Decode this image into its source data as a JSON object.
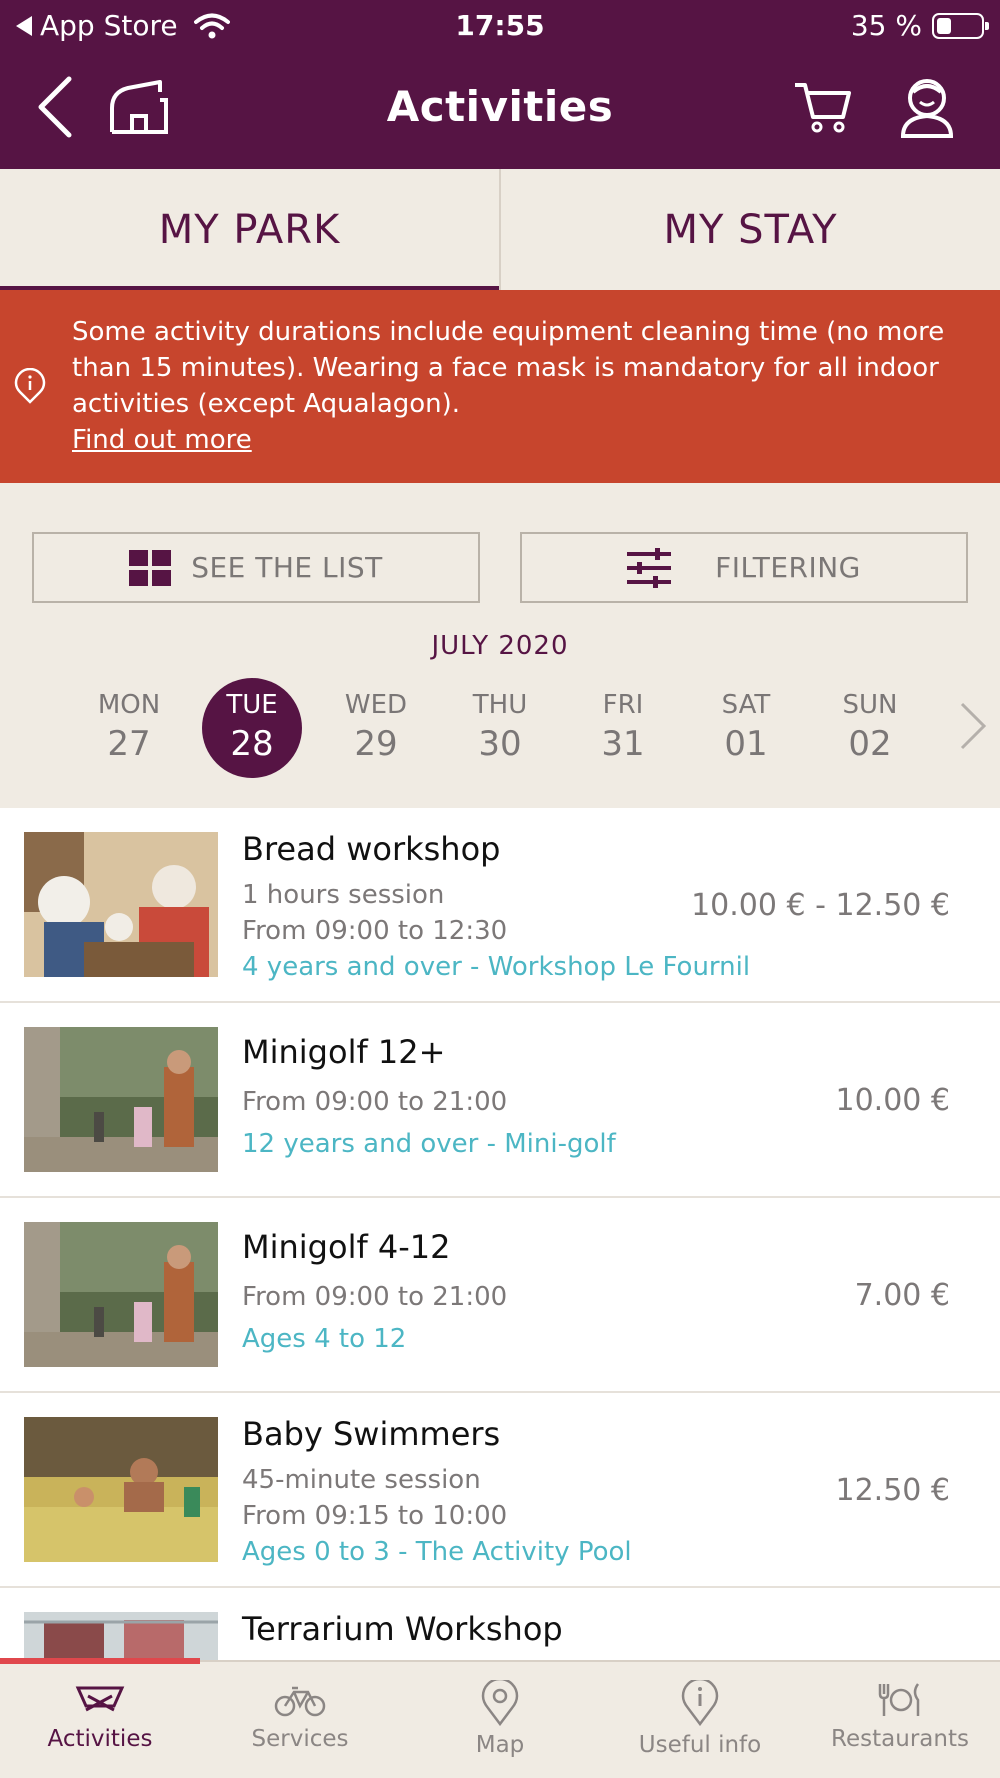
{
  "status_bar": {
    "back_app": "App Store",
    "time": "17:55",
    "battery": "35 %"
  },
  "header": {
    "title": "Activities",
    "back_icon": "chevron-left-icon",
    "home_icon": "home-icon",
    "cart_icon": "cart-icon",
    "profile_icon": "profile-icon"
  },
  "tabs": [
    {
      "label": "MY PARK",
      "active": true
    },
    {
      "label": "MY STAY",
      "active": false
    }
  ],
  "alert": {
    "text": "Some activity durations include equipment cleaning time (no more than 15 minutes). Wearing a face mask is mandatory for all indoor activities (except Aqualagon).",
    "link": "Find out more",
    "icon": "info-icon"
  },
  "buttons": {
    "see_list": "SEE THE LIST",
    "filtering": "FILTERING"
  },
  "calendar": {
    "month": "JULY 2020",
    "days": [
      {
        "name": "MON",
        "date": "27"
      },
      {
        "name": "TUE",
        "date": "28",
        "selected": true
      },
      {
        "name": "WED",
        "date": "29"
      },
      {
        "name": "THU",
        "date": "30"
      },
      {
        "name": "FRI",
        "date": "31"
      },
      {
        "name": "SAT",
        "date": "01"
      },
      {
        "name": "SUN",
        "date": "02"
      }
    ]
  },
  "activities": [
    {
      "title": "Bread workshop",
      "session": "1 hours session",
      "time": "From 09:00 to 12:30",
      "tag": "4 years and over - Workshop Le Fournil",
      "price": "10.00 € - 12.50 €"
    },
    {
      "title": "Minigolf 12+",
      "time": "From 09:00 to 21:00",
      "tag": "12 years and over - Mini-golf",
      "price": "10.00 €"
    },
    {
      "title": "Minigolf 4-12",
      "time": "From 09:00 to 21:00",
      "tag": "Ages 4 to 12",
      "price": "7.00 €"
    },
    {
      "title": "Baby Swimmers",
      "session": "45-minute session",
      "time": "From 09:15 to 10:00",
      "tag": "Ages 0 to 3 - The Activity Pool",
      "price": "12.50 €"
    },
    {
      "title": "Terrarium Workshop"
    }
  ],
  "bottom_nav": [
    {
      "label": "Activities",
      "icon": "activities-icon",
      "active": true
    },
    {
      "label": "Services",
      "icon": "bicycle-icon"
    },
    {
      "label": "Map",
      "icon": "map-pin-icon"
    },
    {
      "label": "Useful info",
      "icon": "info-pin-icon"
    },
    {
      "label": "Restaurants",
      "icon": "cutlery-icon"
    }
  ],
  "colors": {
    "brand": "#561444",
    "alert": "#c7452d",
    "tag": "#4cb6c4",
    "background": "#f0ebe3"
  }
}
